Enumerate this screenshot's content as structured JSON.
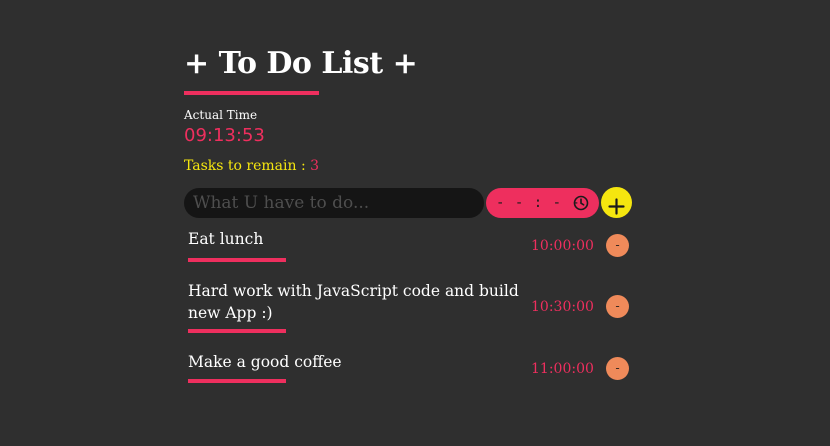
{
  "header": {
    "title": "+ To Do List +"
  },
  "clock": {
    "label": "Actual Time",
    "value": "09:13:53"
  },
  "remaining": {
    "label": "Tasks to remain",
    "separator": " : ",
    "count": "3"
  },
  "form": {
    "task_placeholder": "What U have to do...",
    "task_value": "",
    "time_placeholder": "- - : - -",
    "add_label": "+"
  },
  "tasks": [
    {
      "text": "Eat lunch",
      "time": "10:00:00",
      "remove_label": "-"
    },
    {
      "text": "Hard work with JavaScript code and build new App :)",
      "time": "10:30:00",
      "remove_label": "-"
    },
    {
      "text": "Make a good coffee",
      "time": "11:00:00",
      "remove_label": "-"
    }
  ],
  "icons": {
    "time_input": "clock-icon",
    "add": "plus-icon"
  },
  "colors": {
    "background": "#2f2f2f",
    "accent": "#ee2f5e",
    "highlight": "#f5e60f",
    "remove_button": "#ef8a5a",
    "input_background": "#151515"
  }
}
